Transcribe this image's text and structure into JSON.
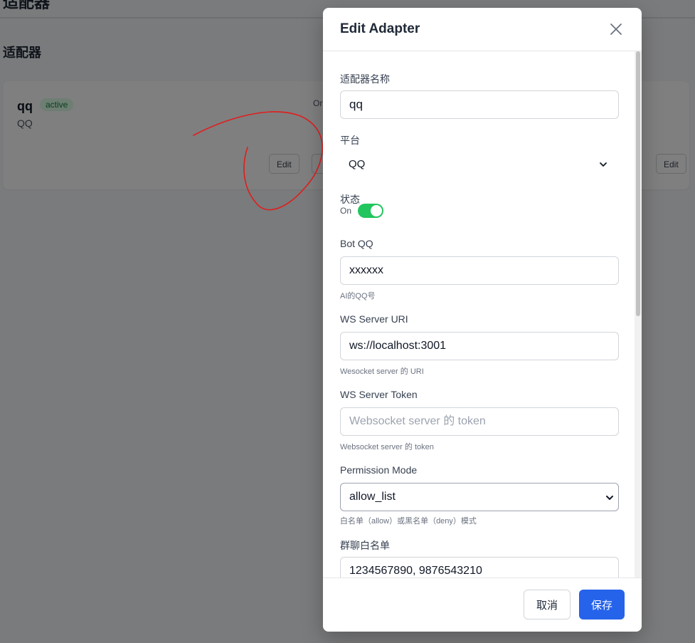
{
  "background": {
    "page_title": "适配器",
    "section_title": "适配器",
    "card": {
      "name": "qq",
      "badge": "active",
      "platform": "QQ",
      "status_snippet": "Or",
      "edit_label": "Edit",
      "edit_label_right": "Edit"
    }
  },
  "modal": {
    "title": "Edit Adapter",
    "fields": {
      "name": {
        "label": "适配器名称",
        "value": "qq"
      },
      "platform": {
        "label": "平台",
        "value": "QQ"
      },
      "status": {
        "label": "状态",
        "toggle_text": "On",
        "enabled": true
      },
      "bot_qq": {
        "label": "Bot QQ",
        "value": "xxxxxx",
        "help": "AI的QQ号"
      },
      "ws_uri": {
        "label": "WS Server URI",
        "value": "ws://localhost:3001",
        "help": "Wesocket server 的 URI"
      },
      "ws_token": {
        "label": "WS Server Token",
        "value": "",
        "placeholder": "Websocket server 的 token",
        "help": "Websocket server 的 token"
      },
      "permission_mode": {
        "label": "Permission Mode",
        "value": "allow_list",
        "help": "白名单（allow）或黑名单（deny）模式"
      },
      "group_whitelist": {
        "label": "群聊白名单",
        "value": "1234567890, 9876543210"
      }
    },
    "footer": {
      "cancel_label": "取消",
      "save_label": "保存"
    }
  },
  "colors": {
    "primary": "#2563eb",
    "toggle_on": "#22c55e",
    "badge_bg": "#dcfce7",
    "badge_text": "#15803d",
    "annotation": "#e11d1d"
  }
}
